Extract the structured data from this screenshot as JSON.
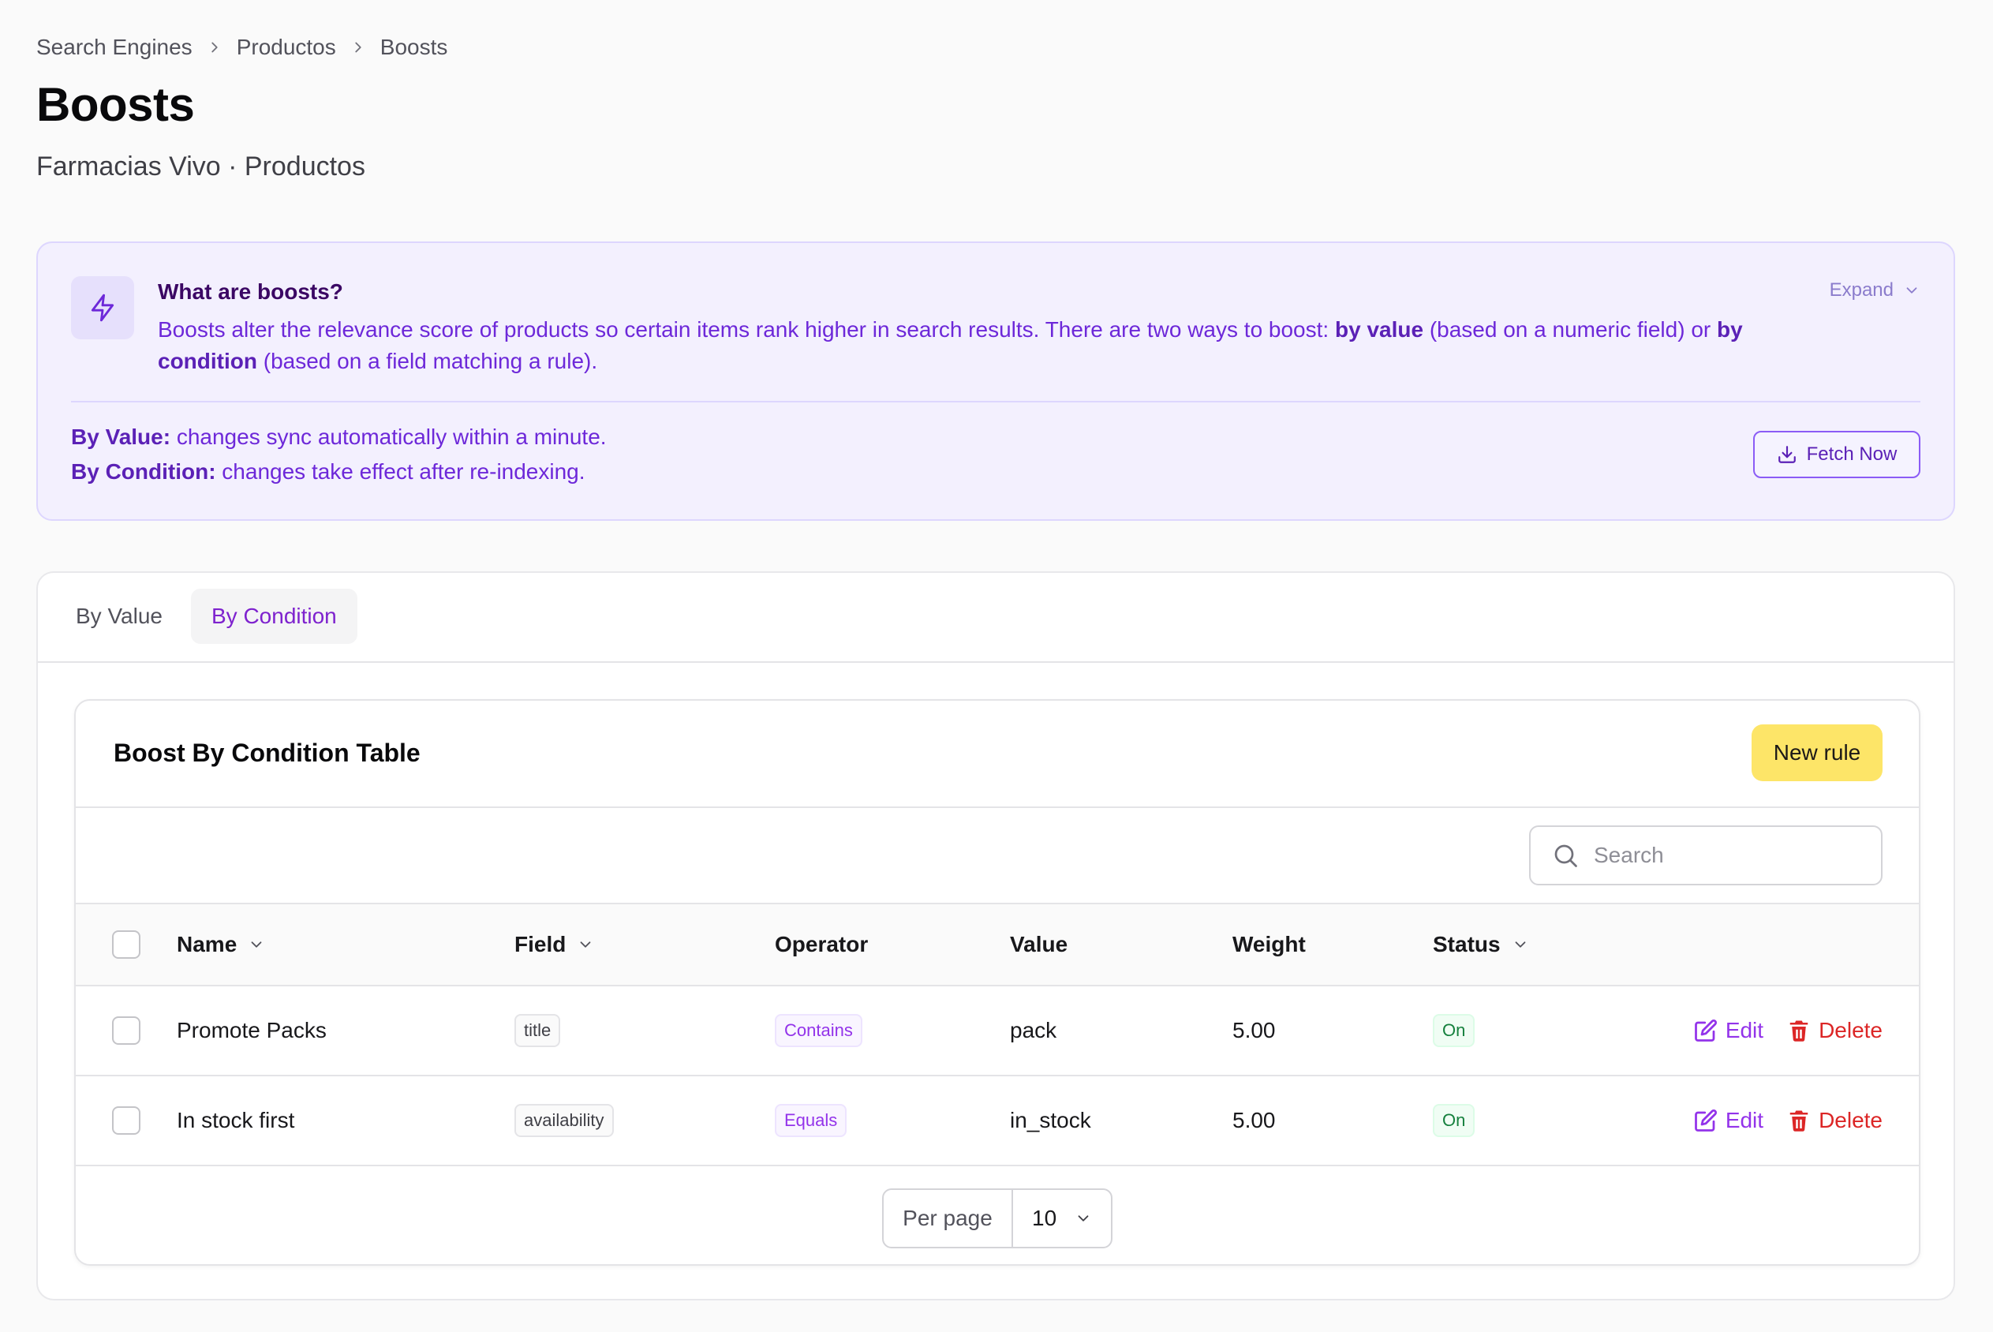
{
  "breadcrumb": {
    "items": [
      "Search Engines",
      "Productos",
      "Boosts"
    ]
  },
  "page": {
    "title": "Boosts",
    "subtitle": "Farmacias Vivo · Productos"
  },
  "info": {
    "heading": "What are boosts?",
    "text_1": "Boosts alter the relevance score of products so certain items rank higher in search results. There are two ways to boost: ",
    "bold_by_value": "by value",
    "text_2": " (based on a numeric field) or ",
    "bold_by_condition": "by condition",
    "text_3": " (based on a field matching a rule).",
    "expand_label": "Expand",
    "sync_value_label": "By Value:",
    "sync_value_text": " changes sync automatically within a minute.",
    "sync_condition_label": "By Condition:",
    "sync_condition_text": " changes take effect after re-indexing.",
    "fetch_label": "Fetch Now",
    "accent_color": "#6d28d9"
  },
  "tabs": [
    {
      "label": "By Value",
      "active": false
    },
    {
      "label": "By Condition",
      "active": true
    }
  ],
  "table": {
    "title": "Boost By Condition Table",
    "new_rule_label": "New rule",
    "search_placeholder": "Search",
    "columns": {
      "name": "Name",
      "field": "Field",
      "operator": "Operator",
      "value": "Value",
      "weight": "Weight",
      "status": "Status"
    },
    "rows": [
      {
        "name": "Promote Packs",
        "field": "title",
        "operator": "Contains",
        "value": "pack",
        "weight": "5.00",
        "status": "On",
        "edit_label": "Edit",
        "delete_label": "Delete"
      },
      {
        "name": "In stock first",
        "field": "availability",
        "operator": "Equals",
        "value": "in_stock",
        "weight": "5.00",
        "status": "On",
        "edit_label": "Edit",
        "delete_label": "Delete"
      }
    ],
    "pagination": {
      "per_page_label": "Per page",
      "per_page_value": "10"
    }
  },
  "colors": {
    "new_rule_bg": "#fde568",
    "edit": "#9333ea",
    "delete": "#dc2626",
    "status_on": "#15803d"
  },
  "icons": [
    "chevron-right-icon",
    "lightning-icon",
    "chevron-down-icon",
    "download-icon",
    "search-icon",
    "edit-icon",
    "trash-icon"
  ]
}
